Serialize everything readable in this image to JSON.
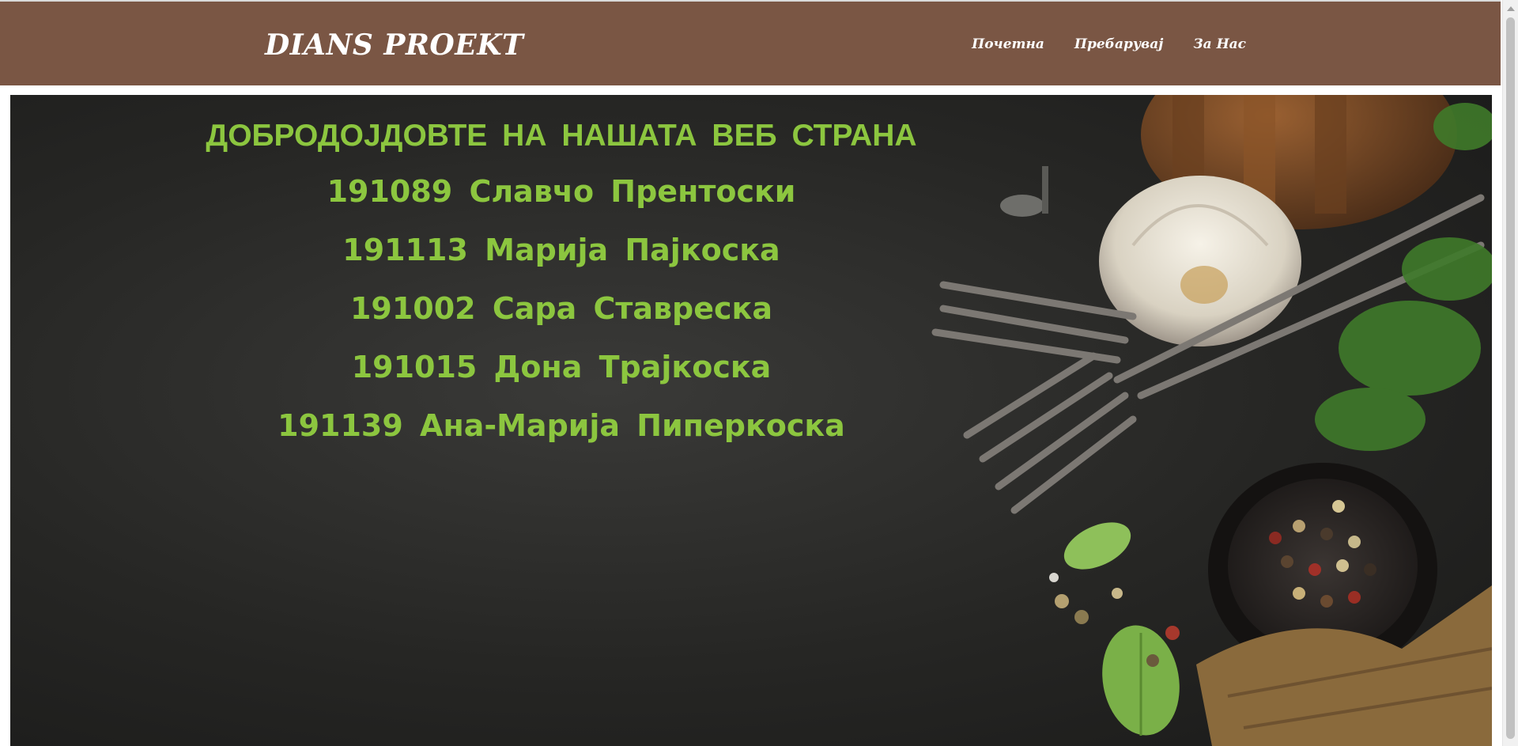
{
  "header": {
    "brand": "DIANS PROEKT",
    "nav": [
      {
        "label": "Почетна"
      },
      {
        "label": "Пребарувај"
      },
      {
        "label": "За Нас"
      }
    ]
  },
  "hero": {
    "welcome": "ДОБРОДОЈДОВТЕ НА НАШАТА ВЕБ СТРАНА",
    "members": [
      "191089 Славчо Прентоски",
      "191113 Марија Пајкоска",
      "191002 Сара Ставреска",
      "191015 Дона Трајкоска",
      "191139 Ана-Марија Пиперкоска"
    ],
    "text_color": "#8cc63f"
  },
  "colors": {
    "header_bg": "#7a5644",
    "hero_bg": "#262624"
  }
}
